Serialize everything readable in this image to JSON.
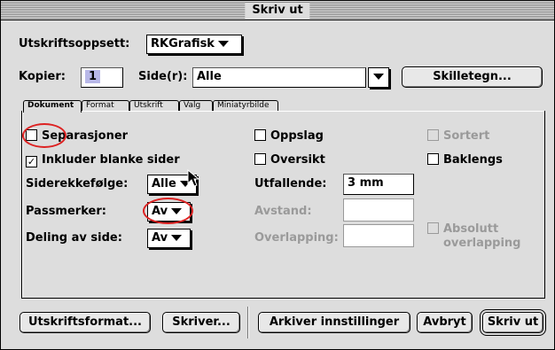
{
  "window": {
    "title": "Skriv ut"
  },
  "setup": {
    "label": "Utskriftsoppsett:",
    "value": "RKGrafisk"
  },
  "copies": {
    "label": "Kopier:",
    "value": "1"
  },
  "pages": {
    "label": "Side(r):",
    "value": "Alle"
  },
  "separator_button": "Skilletegn...",
  "tabs": [
    {
      "label": "Dokument",
      "active": true
    },
    {
      "label": "Format",
      "active": false
    },
    {
      "label": "Utskrift",
      "active": false
    },
    {
      "label": "Valg",
      "active": false
    },
    {
      "label": "Miniatyrbilde",
      "active": false
    }
  ],
  "options": {
    "separations": {
      "label": "Separasjoner",
      "checked": false
    },
    "include_blank": {
      "label": "Inkluder blanke sider",
      "checked": true
    },
    "page_order": {
      "label": "Siderekkefølge:",
      "value": "Alle"
    },
    "registration": {
      "label": "Passmerker:",
      "value": "Av"
    },
    "tiling": {
      "label": "Deling av side:",
      "value": "Av"
    },
    "spreads": {
      "label": "Oppslag",
      "checked": false
    },
    "thumbnails": {
      "label": "Oversikt",
      "checked": false
    },
    "bleed": {
      "label": "Utfallende:",
      "value": "3 mm"
    },
    "offset": {
      "label": "Avstand:",
      "value": ""
    },
    "overlap": {
      "label": "Overlapping:",
      "value": ""
    },
    "collate": {
      "label": "Sortert",
      "checked": false
    },
    "back_to_front": {
      "label": "Baklengs",
      "checked": false
    },
    "absolute_overlap": {
      "label_line1": "Absolutt",
      "label_line2": "overlapping",
      "checked": false
    }
  },
  "buttons": {
    "page_setup": "Utskriftsformat...",
    "printer": "Skriver...",
    "capture_settings": "Arkiver innstillinger",
    "cancel": "Avbryt",
    "print": "Skriv ut"
  },
  "colors": {
    "annotation_circle": "#dd2222",
    "copies_selection": "#b8b8e8"
  }
}
